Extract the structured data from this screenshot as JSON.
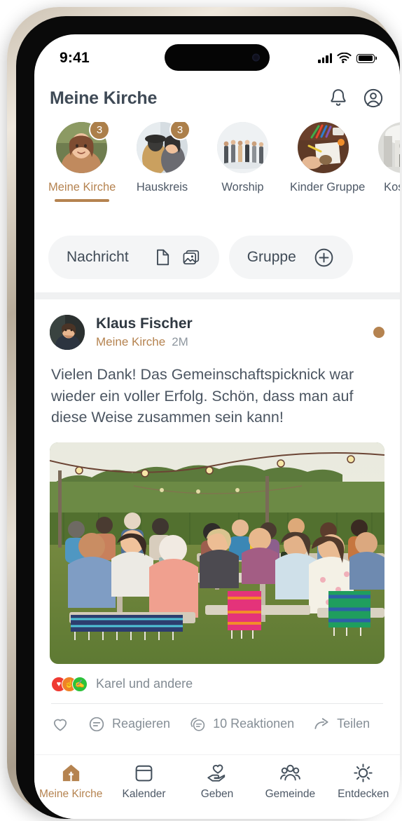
{
  "status_bar": {
    "time": "9:41",
    "icons": [
      "cellular-signal-icon",
      "wifi-icon",
      "battery-icon"
    ]
  },
  "header": {
    "title": "Meine Kirche",
    "notification_icon": "bell-icon",
    "profile_icon": "user-circle-icon"
  },
  "stories": [
    {
      "label": "Meine Kirche",
      "badge": "3",
      "active": true
    },
    {
      "label": "Hauskreis",
      "badge": "3",
      "active": false
    },
    {
      "label": "Worship",
      "badge": "",
      "active": false
    },
    {
      "label": "Kinder Gruppe",
      "badge": "",
      "active": false
    },
    {
      "label": "Kostbar",
      "badge": "",
      "active": false
    }
  ],
  "composer": {
    "message_label": "Nachricht",
    "document_icon": "document-icon",
    "photo_icon": "photo-stack-icon",
    "group_label": "Gruppe",
    "group_icon": "plus-circle-icon"
  },
  "post": {
    "author": "Klaus Fischer",
    "group": "Meine Kirche",
    "time": "2M",
    "unread_dot": "unread-dot",
    "text": "Vielen Dank! Das Gemeinschaftspicknick war wieder ein voller Erfolg. Schön, dass man auf diese Weise zusammen sein kann!",
    "image_alt": "community-picnic-photo",
    "reactions_summary": "Karel und andere",
    "reaction_emojis": [
      "♥",
      "👍",
      "🙌"
    ],
    "actions": {
      "like_icon": "heart-icon",
      "react_icon": "speech-bubble-icon",
      "react_label": "Reagieren",
      "reactions_count_icon": "double-bubble-icon",
      "reactions_count_label": "10 Reaktionen",
      "share_icon": "share-arrow-icon",
      "share_label": "Teilen"
    }
  },
  "tabbar": [
    {
      "label": "Meine Kirche",
      "icon": "church-home-icon",
      "active": true
    },
    {
      "label": "Kalender",
      "icon": "calendar-icon",
      "active": false
    },
    {
      "label": "Geben",
      "icon": "hand-heart-icon",
      "active": false
    },
    {
      "label": "Gemeinde",
      "icon": "people-group-icon",
      "active": false
    },
    {
      "label": "Entdecken",
      "icon": "sun-icon",
      "active": false
    }
  ],
  "colors": {
    "accent": "#b58350",
    "badge": "#ac7f4a",
    "text_dark": "#3f4a56",
    "text_muted": "#858e96",
    "pill_bg": "#f4f5f6"
  }
}
